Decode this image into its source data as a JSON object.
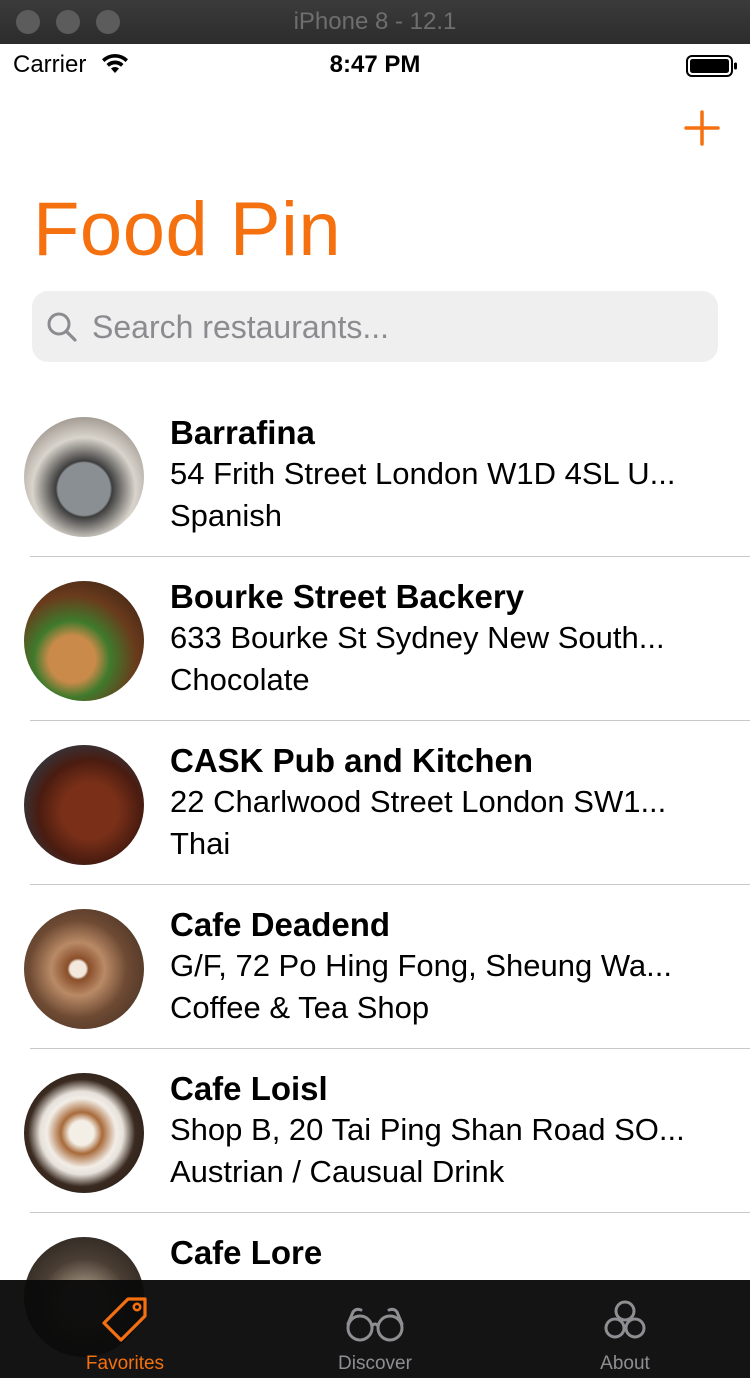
{
  "window": {
    "title": "iPhone 8 - 12.1"
  },
  "status_bar": {
    "carrier": "Carrier",
    "time": "8:47 PM"
  },
  "nav": {
    "title": "Food Pin",
    "add_icon": "plus-icon"
  },
  "search": {
    "placeholder": "Search restaurants..."
  },
  "restaurants": [
    {
      "name": "Barrafina",
      "location": "54 Frith Street London W1D 4SL U...",
      "type": "Spanish",
      "image": "plated-dish-photo"
    },
    {
      "name": "Bourke Street Backery",
      "location": "633 Bourke St Sydney New South...",
      "type": "Chocolate",
      "image": "sandwich-photo"
    },
    {
      "name": "CASK Pub and Kitchen",
      "location": "22 Charlwood Street London SW1...",
      "type": "Thai",
      "image": "braised-meat-photo"
    },
    {
      "name": "Cafe Deadend",
      "location": "G/F, 72 Po Hing Fong, Sheung Wa...",
      "type": "Coffee & Tea Shop",
      "image": "latte-on-tray-photo"
    },
    {
      "name": "Cafe Loisl",
      "location": "Shop B, 20 Tai Ping Shan Road SO...",
      "type": "Austrian / Causual Drink",
      "image": "latte-art-photo"
    },
    {
      "name": "Cafe Lore",
      "location": "",
      "type": "",
      "image": "cafe-table-photo"
    }
  ],
  "tabs": [
    {
      "label": "Favorites",
      "icon": "tag-icon",
      "selected": true
    },
    {
      "label": "Discover",
      "icon": "glasses-icon",
      "selected": false
    },
    {
      "label": "About",
      "icon": "circles-icon",
      "selected": false
    }
  ],
  "colors": {
    "accent": "#F5700F",
    "tab_inactive": "#8E8E93",
    "separator": "#C8C7CC",
    "search_bg": "#EFEFF0"
  }
}
